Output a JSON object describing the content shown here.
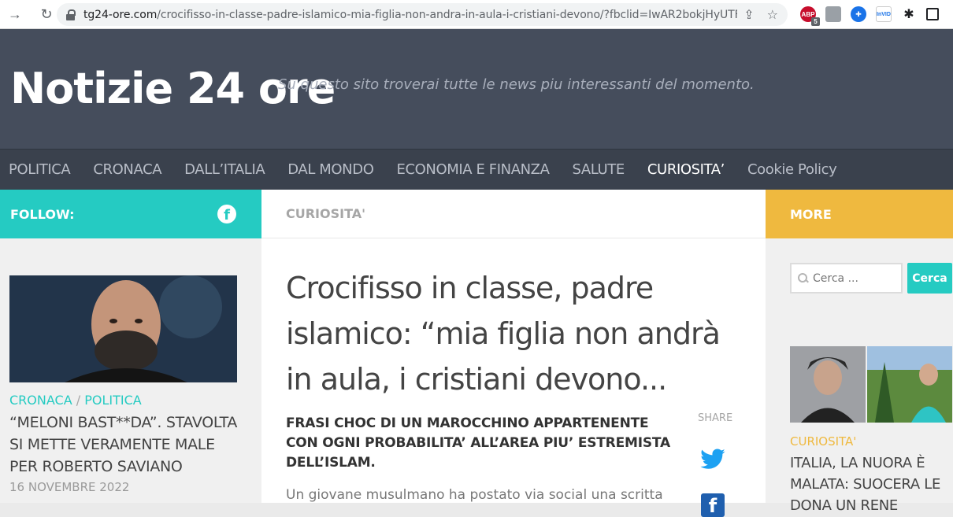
{
  "browser": {
    "url_host": "tg24-ore.com",
    "url_path": "/crocifisso-in-classe-padre-islamico-mia-figlia-non-andra-in-aula-i-cristiani-devono/?fbclid=IwAR2bokjHyUTFflM0...",
    "abp_badge": "5",
    "abp_label": "ABP",
    "invid_label": "InVID"
  },
  "header": {
    "site_title": "Notizie 24 ore",
    "tagline": "Su questo sito troverai tutte le news piu interessanti del momento."
  },
  "nav": {
    "items": [
      {
        "label": "POLITICA",
        "active": false
      },
      {
        "label": "CRONACA",
        "active": false
      },
      {
        "label": "DALL’ITALIA",
        "active": false
      },
      {
        "label": "DAL MONDO",
        "active": false
      },
      {
        "label": "ECONOMIA E FINANZA",
        "active": false
      },
      {
        "label": "SALUTE",
        "active": false
      },
      {
        "label": "CURIOSITA’",
        "active": true
      },
      {
        "label": "Cookie Policy",
        "active": false
      }
    ]
  },
  "follow": {
    "label": "FOLLOW:",
    "fb_glyph": "f"
  },
  "category_bar": {
    "label": "CURIOSITA'"
  },
  "more": {
    "label": "MORE"
  },
  "left_post": {
    "cat1": "CRONACA",
    "separator": "/",
    "cat2": "POLITICA",
    "title": "“MELONI BAST**DA”. STAVOLTA SI METTE VERAMENTE MALE PER ROBERTO SAVIANO",
    "date": "16 NOVEMBRE 2022"
  },
  "article": {
    "title": "Crocifisso in classe, padre islamico: “mia figlia non andrà in aula, i cristiani devono...",
    "lead": "FRASI CHOC DI UN MAROCCHINO APPARTENENTE CON OGNI PROBABILITA’ ALL’AREA PIU’ ESTREMISTA DELL’ISLAM.",
    "share_label": "SHARE",
    "body_start": "Un giovane musulmano ha postato via social una scritta",
    "fb_glyph": "f"
  },
  "right_sidebar": {
    "search_placeholder": "Cerca ...",
    "search_button": "Cerca",
    "post_cat": "CURIOSITA'",
    "post_title": "ITALIA, LA NUORA È MALATA: SUOCERA LE DONA UN RENE"
  },
  "colors": {
    "teal": "#25cbc2",
    "gold": "#efb93f",
    "header": "#454d5c",
    "nav": "#3a414d"
  }
}
